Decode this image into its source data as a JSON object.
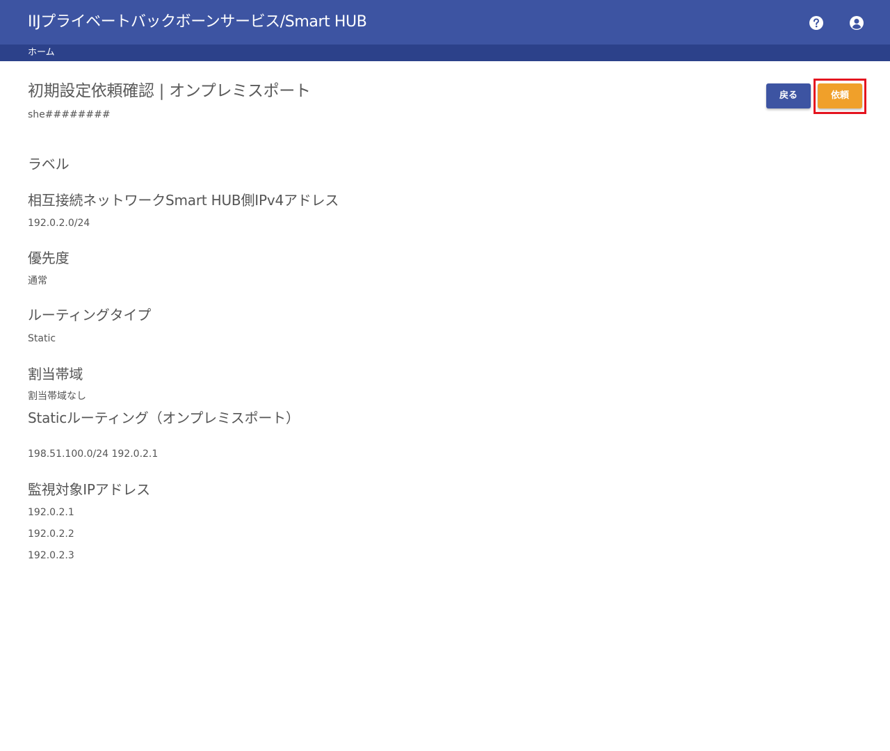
{
  "header": {
    "title": "IIJプライベートバックボーンサービス/Smart HUB",
    "icons": [
      "help-icon",
      "account-icon"
    ],
    "color": "#3d54a2"
  },
  "breadcrumb": {
    "home": "ホーム",
    "color": "#2c418a"
  },
  "page": {
    "title": "初期設定依頼確認 | オンプレミスポート",
    "subtitle": "she########"
  },
  "actions": {
    "back_label": "戻る",
    "request_label": "依頼",
    "back_color": "#3d54a2",
    "request_color": "#f0a02a",
    "highlight_color": "#e4141f"
  },
  "sections": {
    "label": {
      "heading": "ラベル"
    },
    "ipv4": {
      "heading": "相互接続ネットワークSmart HUB側IPv4アドレス",
      "value": "192.0.2.0/24"
    },
    "priority": {
      "heading": "優先度",
      "value": "通常"
    },
    "routing_type": {
      "heading": "ルーティングタイプ",
      "value": "Static"
    },
    "bandwidth": {
      "heading": "割当帯域",
      "value": "割当帯域なし"
    },
    "static_routing": {
      "heading": "Staticルーティング（オンプレミスポート）",
      "value": "198.51.100.0/24 192.0.2.1"
    },
    "monitor_ips": {
      "heading": "監視対象IPアドレス",
      "values": [
        "192.0.2.1",
        "192.0.2.2",
        "192.0.2.3"
      ]
    }
  }
}
